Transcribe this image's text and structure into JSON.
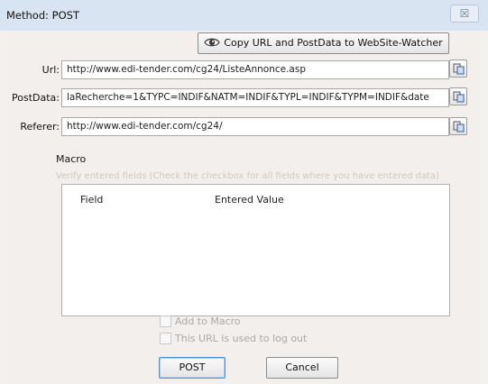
{
  "window": {
    "title": "Method: POST",
    "close_glyph": "☒"
  },
  "toolbar": {
    "copy_label": "Copy URL and PostData to WebSite-Watcher"
  },
  "form": {
    "url_label": "Url:",
    "url_value": "http://www.edi-tender.com/cg24/ListeAnnonce.asp",
    "postdata_label": "PostData:",
    "postdata_value": "laRecherche=1&TYPC=INDIF&NATM=INDIF&TYPL=INDIF&TYPM=INDIF&date",
    "referer_label": "Referer:",
    "referer_value": "http://www.edi-tender.com/cg24/"
  },
  "macro": {
    "title": "Macro",
    "hint": "Verify entered fields (Check the checkbox for all fields where you have entered data)",
    "columns": [
      "Field",
      "Entered Value"
    ],
    "add_to_macro_label": "Add to Macro",
    "logout_label": "This URL is used to log out"
  },
  "buttons": {
    "post_label": "POST",
    "cancel_label": "Cancel"
  },
  "colors": {
    "titlebar": "#d9e4f2",
    "dialog_bg": "#f2efec",
    "default_button_border": "#4f8fd0"
  },
  "icons": [
    "eye-icon",
    "paste-icon",
    "close-icon"
  ]
}
